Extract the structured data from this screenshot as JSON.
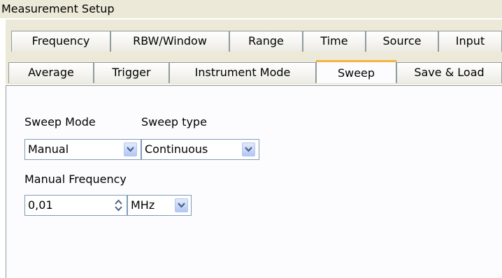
{
  "window": {
    "title": "Measurement Setup"
  },
  "tabs_row1": [
    {
      "label": "Frequency"
    },
    {
      "label": "RBW/Window"
    },
    {
      "label": "Range"
    },
    {
      "label": "Time"
    },
    {
      "label": "Source"
    },
    {
      "label": "Input"
    }
  ],
  "tabs_row2": [
    {
      "label": "Average"
    },
    {
      "label": "Trigger"
    },
    {
      "label": "Instrument Mode"
    },
    {
      "label": "Sweep"
    },
    {
      "label": "Save & Load"
    }
  ],
  "active_tab": "Sweep",
  "sweep": {
    "mode_label": "Sweep Mode",
    "mode_value": "Manual",
    "type_label": "Sweep type",
    "type_value": "Continuous",
    "manual_freq_label": "Manual Frequency",
    "manual_freq_value": "0,01",
    "manual_freq_unit": "MHz"
  },
  "colors": {
    "window_bg": "#ece9d8",
    "panel_bg": "#fcfcfe",
    "active_tab_accent": "#f7b33e",
    "border": "#919b9c",
    "field_border": "#7f9db9"
  },
  "icons": {
    "dropdown": "chevron-down-icon",
    "spinner": "up-down-arrows-icon"
  }
}
